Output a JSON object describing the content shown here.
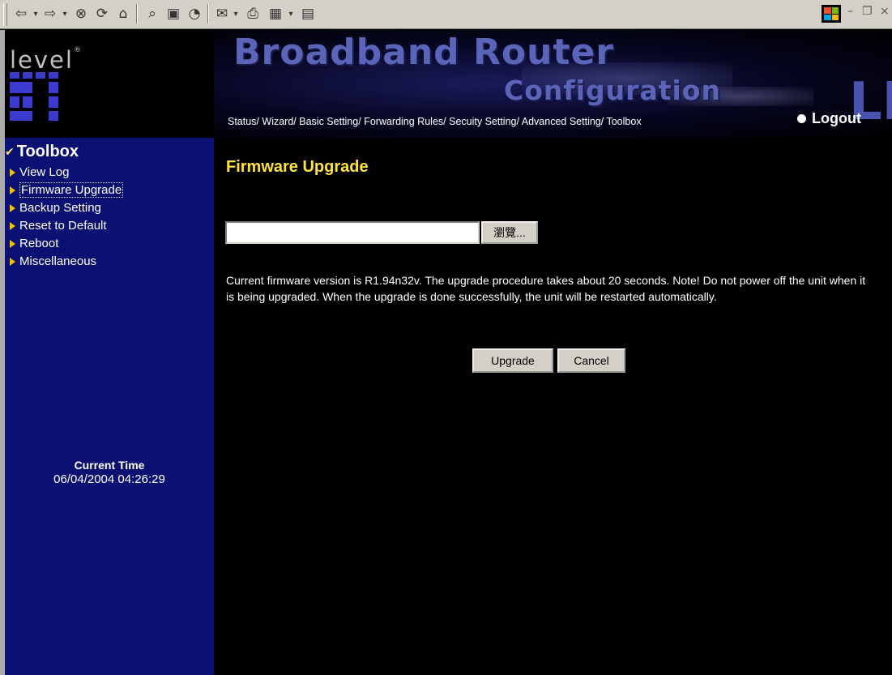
{
  "browser": {
    "toolbar_icons": [
      "back-arrow-icon",
      "dropdown-icon",
      "forward-arrow-icon",
      "dropdown-icon",
      "stop-icon",
      "refresh-icon",
      "home-icon",
      "search-icon",
      "favorites-icon",
      "history-icon",
      "mail-icon",
      "print-icon",
      "edit-icon",
      "dropdown-icon",
      "discuss-icon"
    ],
    "window_controls": [
      "minimize-icon",
      "restore-icon",
      "close-icon"
    ]
  },
  "logo": {
    "brand": "level",
    "reg": "®"
  },
  "banner": {
    "title_line1": "Broadband Router",
    "title_line2": "Configuration",
    "brand_letters": "LE"
  },
  "nav": {
    "items": [
      "Status/",
      "Wizard/",
      "Basic Setting/",
      "Forwarding Rules/",
      "Secuity Setting/",
      "Advanced Setting/",
      "Toolbox"
    ],
    "logout_label": "Logout"
  },
  "sidebar": {
    "heading": "Toolbox",
    "items": [
      {
        "label": "View Log"
      },
      {
        "label": "Firmware Upgrade"
      },
      {
        "label": "Backup Setting"
      },
      {
        "label": "Reset to Default"
      },
      {
        "label": "Reboot"
      },
      {
        "label": "Miscellaneous"
      }
    ],
    "selected": "Firmware Upgrade",
    "time_label": "Current Time",
    "time_value": "06/04/2004 04:26:29"
  },
  "main": {
    "title": "Firmware Upgrade",
    "file_value": "",
    "browse_label": "瀏覽...",
    "note": "Current firmware version is R1.94n32v. The upgrade procedure takes about 20 seconds. Note! Do not power off the unit when it is being upgraded. When the upgrade is done successfully, the unit will be restarted automatically.",
    "upgrade_label": "Upgrade",
    "cancel_label": "Cancel"
  },
  "colors": {
    "sidebar_bg": "#0a1173",
    "title_yellow": "#ffe23a",
    "arrow_yellow": "#f0c000"
  }
}
